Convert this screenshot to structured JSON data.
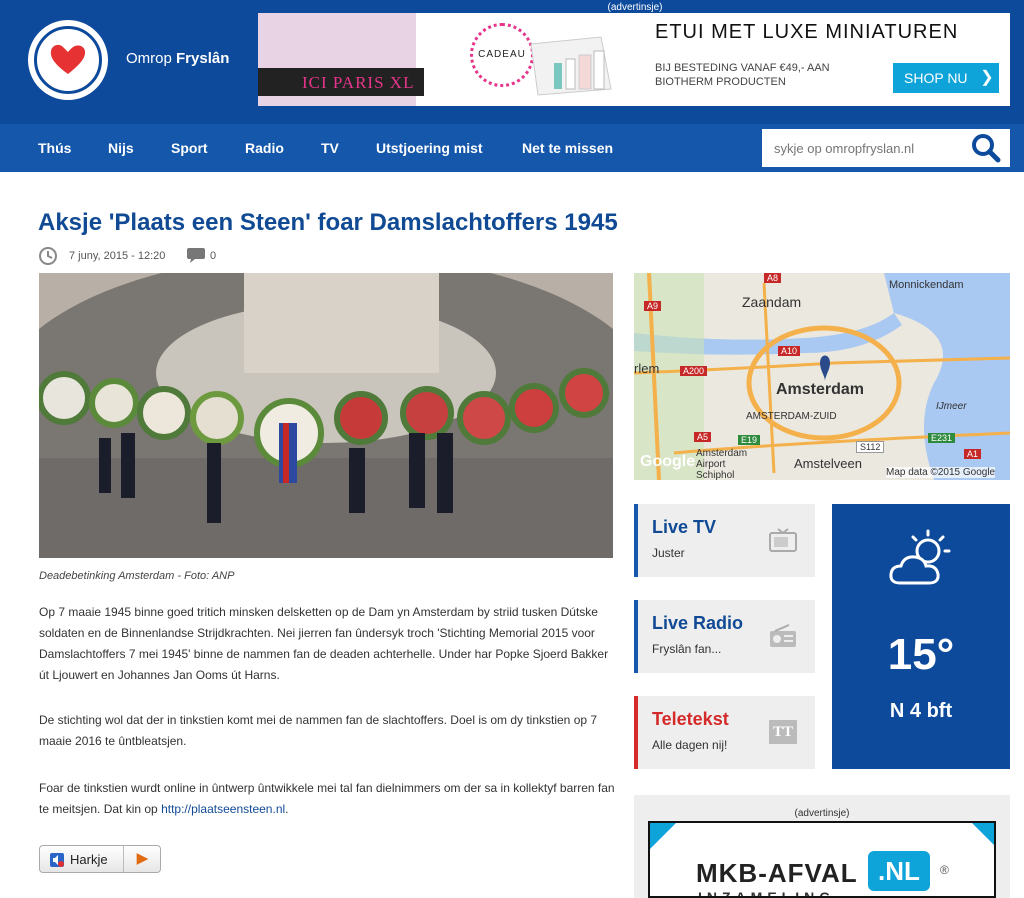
{
  "brand": {
    "name_prefix": "Omrop",
    "name_bold": "Fryslân"
  },
  "top_ad": {
    "label": "(advertinsje)",
    "ici_text": "ICI PARIS XL",
    "cadeau_text": "CADEAU",
    "title": "ETUI MET LUXE MINIATUREN",
    "subtitle": "BIJ BESTEDING VANAF €49,- AAN BIOTHERM PRODUCTEN",
    "shop_label": "SHOP NU",
    "shop_arrow": "❯"
  },
  "nav": {
    "items": [
      {
        "label": "Thús"
      },
      {
        "label": "Nijs"
      },
      {
        "label": "Sport"
      },
      {
        "label": "Radio"
      },
      {
        "label": "TV"
      },
      {
        "label": "Utstjoering mist"
      },
      {
        "label": "Net te missen"
      }
    ],
    "search_placeholder": "sykje op omropfryslan.nl"
  },
  "article": {
    "title": "Aksje 'Plaats een Steen' foar Damslachtoffers 1945",
    "date": "7 juny, 2015 - 12:20",
    "comment_count": "0",
    "caption": "Deadebetinking Amsterdam   -   Foto: ANP",
    "paragraphs": [
      "Op 7 maaie 1945 binne goed tritich minsken delsketten op de Dam yn Amsterdam by striid tusken Dútske soldaten en de Binnenlandse Strijdkrachten. Nei jierren fan ûndersyk troch 'Stichting Memorial 2015 voor Damslachtoffers 7 mei 1945' binne de nammen fan de deaden achterhelle. Under har Popke Sjoerd Bakker út Ljouwert en Johannes Jan Ooms út Harns.",
      "De stichting wol dat der in tinkstien komt mei de nammen fan de slachtoffers. Doel is om dy tinkstien op 7 maaie 2016 te ûntbleatsjen."
    ],
    "para3_text": "Foar de tinkstien wurdt online in ûntwerp ûntwikkele mei tal fan dielnimmers om der sa in kollektyf barren fan te meitsjen. Dat kin op ",
    "para3_link": "http://plaatseensteen.nl",
    "para3_end": ".",
    "listen_label": "Harkje"
  },
  "map": {
    "labels": [
      "Zaandam",
      "Monnickendam",
      "rlem",
      "Amsterdam",
      "AMSTERDAM-ZUID",
      "IJmeer",
      "Amsterdam Airport Schiphol",
      "Amstelveen",
      "Google",
      "Map data ©2015 Google"
    ],
    "roads": [
      "A8",
      "A9",
      "A10",
      "A200",
      "A5",
      "E19",
      "S112",
      "E231",
      "A1"
    ]
  },
  "tiles": [
    {
      "title": "Live TV",
      "subtitle": "Juster",
      "accent": "#1457ab",
      "title_color": "#114a94"
    },
    {
      "title": "Live Radio",
      "subtitle": "Fryslân fan...",
      "accent": "#1457ab",
      "title_color": "#114a94"
    },
    {
      "title": "Teletekst",
      "subtitle": "Alle dagen nij!",
      "accent": "#d42a2a",
      "title_color": "#d42a2a",
      "icon_text": "TT"
    }
  ],
  "weather": {
    "temp": "15°",
    "wind": "N 4 bft"
  },
  "side_ad": {
    "label": "(advertinsje)",
    "logo_text": "MKB-AFVAL",
    "nl_text": ".NL",
    "reg": "®",
    "sub": "INZAMELING"
  },
  "colors": {
    "header": "#0d4a9c",
    "nav": "#1457ab",
    "title": "#114a94",
    "accent_red": "#d42a2a",
    "ad_pink": "#e6358b",
    "ad_blue": "#0ea4d9"
  }
}
